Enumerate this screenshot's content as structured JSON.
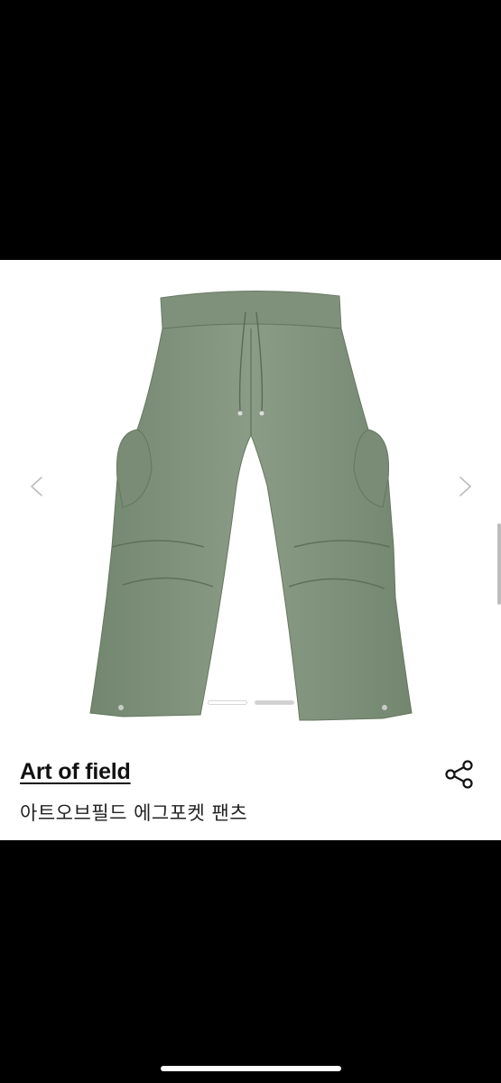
{
  "product": {
    "brand": "Art of field",
    "name": "아트오브필드 에그포켓 팬츠",
    "color": "#7d8f79"
  },
  "gallery": {
    "image_icon": "cargo-pants-image",
    "prev_icon": "chevron-left-icon",
    "next_icon": "chevron-right-icon",
    "page_count": 2,
    "active_page": 1
  },
  "actions": {
    "share_icon": "share-icon"
  }
}
